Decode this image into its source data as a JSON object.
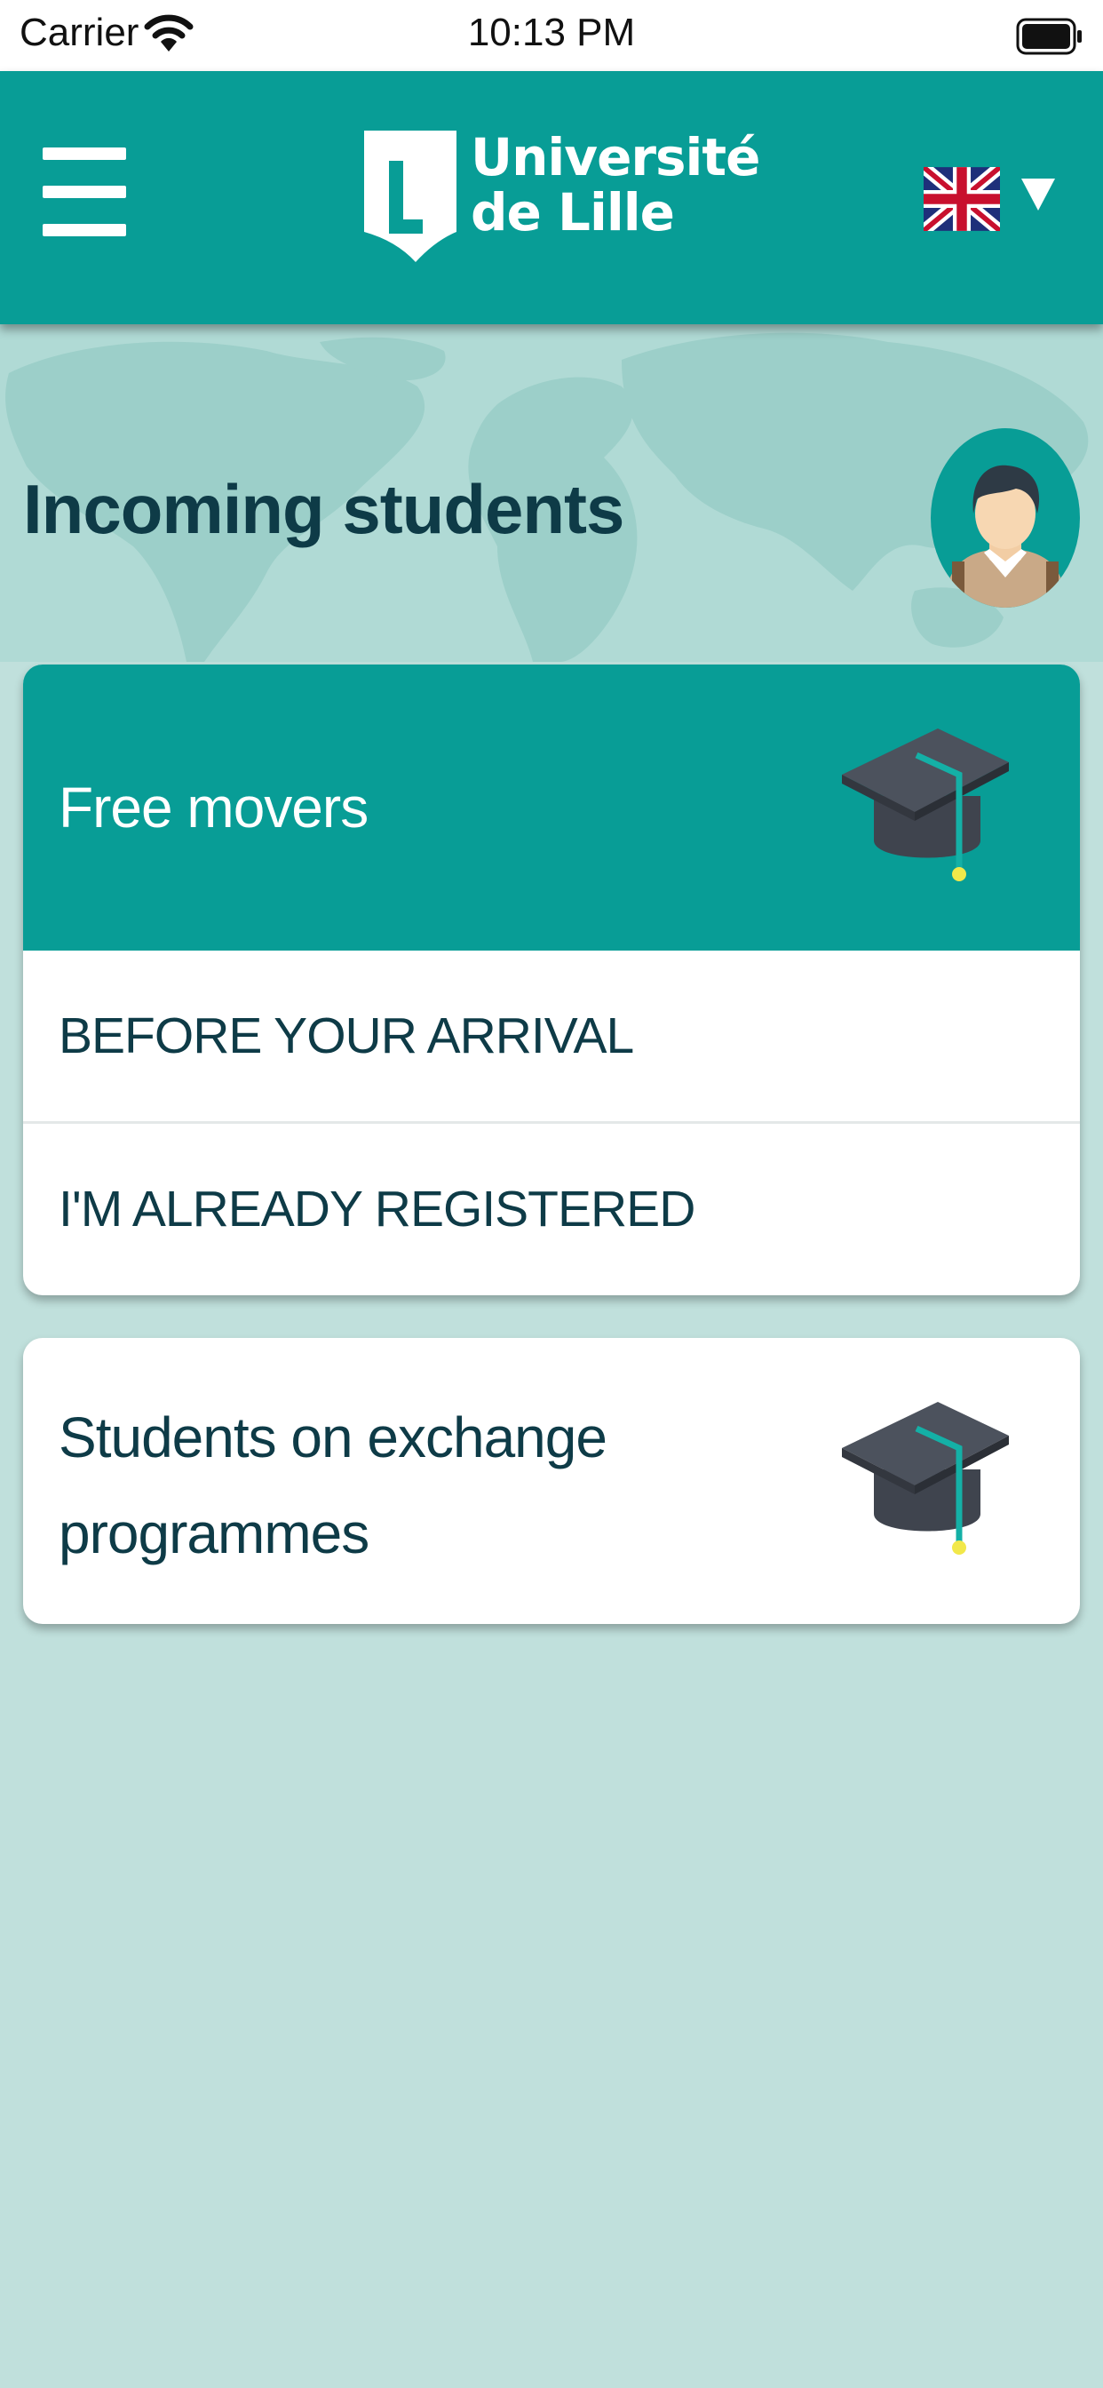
{
  "status_bar": {
    "carrier": "Carrier",
    "time": "10:13 PM"
  },
  "header": {
    "logo_line1": "Université",
    "logo_line2": "de Lille",
    "menu_icon": "hamburger-menu-icon",
    "language_flag": "uk-flag-icon",
    "language_dropdown_icon": "triangle-down-icon"
  },
  "page": {
    "title": "Incoming students",
    "avatar": "student-avatar"
  },
  "sections": [
    {
      "title": "Free movers",
      "icon": "graduation-cap-icon",
      "expanded": true,
      "items": [
        {
          "label": "BEFORE YOUR ARRIVAL"
        },
        {
          "label": "I'M ALREADY REGISTERED"
        }
      ]
    },
    {
      "title": "Students on exchange programmes",
      "icon": "graduation-cap-icon",
      "expanded": false
    }
  ],
  "colors": {
    "primary": "#089d96",
    "background": "#c0e0dc",
    "text_dark": "#0e3b47",
    "accent_yellow": "#f2e84a"
  }
}
